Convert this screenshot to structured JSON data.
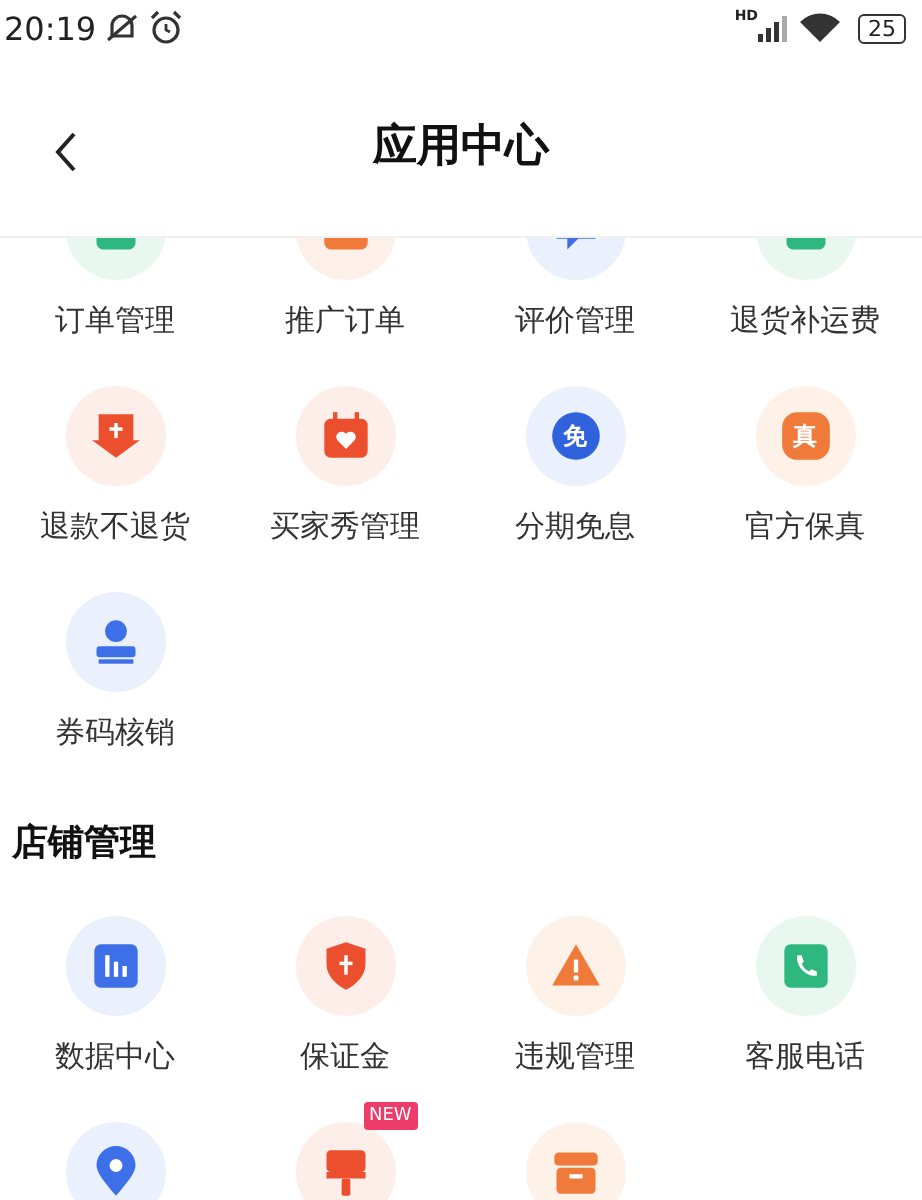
{
  "status_bar": {
    "time": "20:19",
    "network_label": "HD",
    "battery": "25"
  },
  "header": {
    "title": "应用中心"
  },
  "sections": [
    {
      "items": [
        {
          "label": "订单管理",
          "kind": "order"
        },
        {
          "label": "推广订单",
          "kind": "promo"
        },
        {
          "label": "评价管理",
          "kind": "review"
        },
        {
          "label": "退货补运费",
          "kind": "freight"
        },
        {
          "label": "退款不退货",
          "kind": "refund"
        },
        {
          "label": "买家秀管理",
          "kind": "show"
        },
        {
          "label": "分期免息",
          "kind": "installment",
          "glyph": "免"
        },
        {
          "label": "官方保真",
          "kind": "genuine",
          "glyph": "真"
        },
        {
          "label": "券码核销",
          "kind": "coupon"
        }
      ]
    },
    {
      "title": "店铺管理",
      "items": [
        {
          "label": "数据中心",
          "kind": "data"
        },
        {
          "label": "保证金",
          "kind": "deposit"
        },
        {
          "label": "违规管理",
          "kind": "violation"
        },
        {
          "label": "客服电话",
          "kind": "phone"
        },
        {
          "kind": "location"
        },
        {
          "kind": "decor",
          "badge": "NEW"
        },
        {
          "kind": "store"
        }
      ]
    }
  ]
}
